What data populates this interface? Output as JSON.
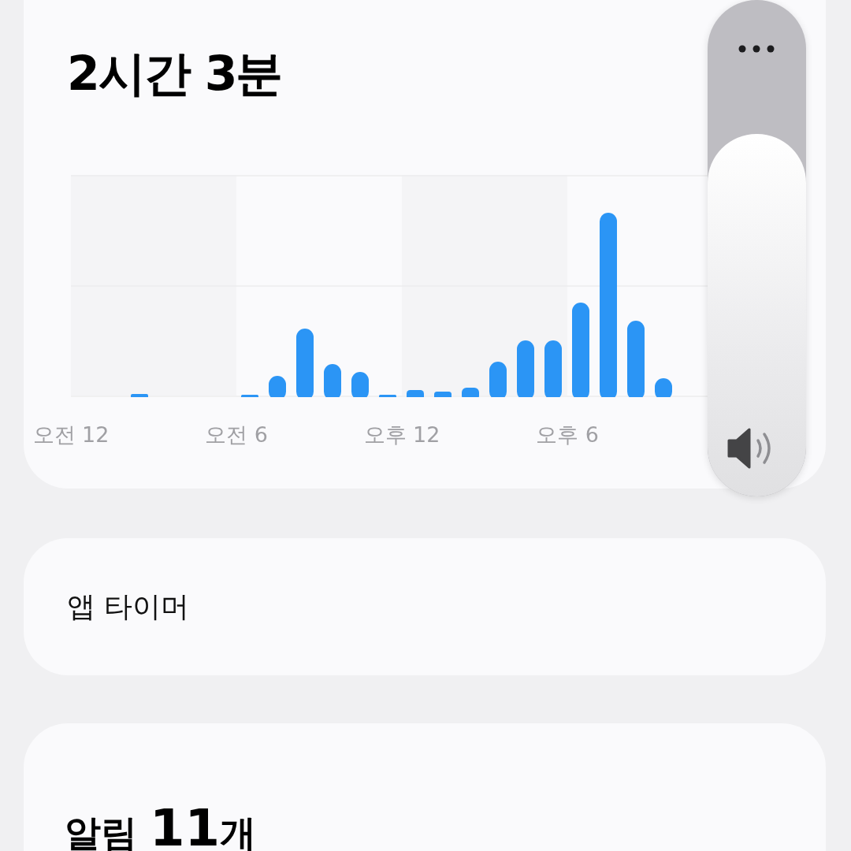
{
  "usage_card": {
    "total": "2시간 3분",
    "x_labels": [
      "오전 12",
      "오전 6",
      "오후 12",
      "오후 6"
    ]
  },
  "volume": {
    "level": 0.73
  },
  "app_timer": {
    "label": "앱 타이머"
  },
  "notifications": {
    "label": "알림",
    "count": "11",
    "unit": "개"
  }
}
